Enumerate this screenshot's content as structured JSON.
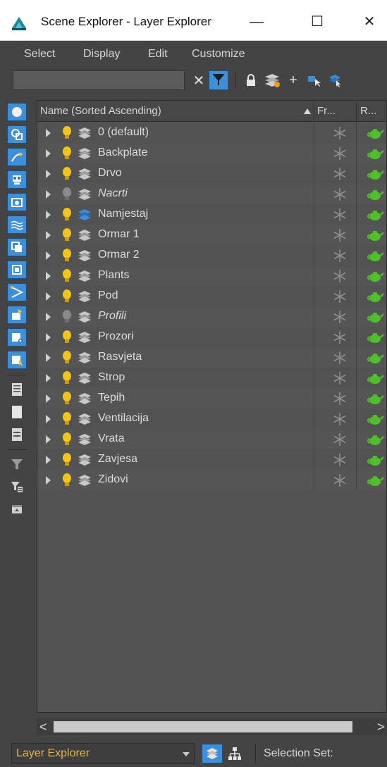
{
  "window": {
    "title": "Scene Explorer - Layer Explorer",
    "minimize_glyph": "—",
    "maximize_glyph": "☐",
    "close_glyph": "✕"
  },
  "menu": [
    "Select",
    "Display",
    "Edit",
    "Customize"
  ],
  "toolbar": {
    "search_value": "",
    "clear_glyph": "✕",
    "add_glyph": "+",
    "icons": [
      "clear-search-icon",
      "filter-icon",
      "lock-icon",
      "new-layer-icon",
      "add-to-layer-icon",
      "select-in-layer-icon",
      "set-current-layer-icon"
    ]
  },
  "sidebar_icons": [
    "display-all-icon",
    "geometry-filter-icon",
    "shapes-filter-icon",
    "lights-filter-icon",
    "cameras-filter-icon",
    "spacewarps-filter-icon",
    "groups-filter-icon",
    "xrefs-filter-icon",
    "helpers-filter-icon",
    "bones-filter-icon",
    "particles-filter-icon",
    "containers-filter-icon",
    "select-all-icon",
    "select-none-icon",
    "select-invert-icon",
    "filter-funnel-icon",
    "filter-options-icon",
    "collapse-icon"
  ],
  "columns": {
    "name": "Name (Sorted Ascending)",
    "freeze": "Fr...",
    "render": "R..."
  },
  "colors": {
    "accent_blue": "#3c8fd8",
    "bulb_on": "#f0c419",
    "bulb_off": "#8a8a8a",
    "render_green": "#4fbf2a",
    "explorer_label": "#e8b440"
  },
  "layers": [
    {
      "name": "0 (default)",
      "hidden": false,
      "active": false
    },
    {
      "name": "Backplate",
      "hidden": false,
      "active": false
    },
    {
      "name": "Drvo",
      "hidden": false,
      "active": false
    },
    {
      "name": "Nacrti",
      "hidden": true,
      "active": false
    },
    {
      "name": "Namjestaj",
      "hidden": false,
      "active": true
    },
    {
      "name": "Ormar 1",
      "hidden": false,
      "active": false
    },
    {
      "name": "Ormar 2",
      "hidden": false,
      "active": false
    },
    {
      "name": "Plants",
      "hidden": false,
      "active": false
    },
    {
      "name": "Pod",
      "hidden": false,
      "active": false
    },
    {
      "name": "Profili",
      "hidden": true,
      "active": false
    },
    {
      "name": "Prozori",
      "hidden": false,
      "active": false
    },
    {
      "name": "Rasvjeta",
      "hidden": false,
      "active": false
    },
    {
      "name": "Strop",
      "hidden": false,
      "active": false
    },
    {
      "name": "Tepih",
      "hidden": false,
      "active": false
    },
    {
      "name": "Ventilacija",
      "hidden": false,
      "active": false
    },
    {
      "name": "Vrata",
      "hidden": false,
      "active": false
    },
    {
      "name": "Zavjesa",
      "hidden": false,
      "active": false
    },
    {
      "name": "Zidovi",
      "hidden": false,
      "active": false
    }
  ],
  "scrollbar": {
    "left_glyph": "<",
    "right_glyph": ">"
  },
  "status": {
    "explorer_name": "Layer Explorer",
    "selection_set_label": "Selection Set:"
  }
}
